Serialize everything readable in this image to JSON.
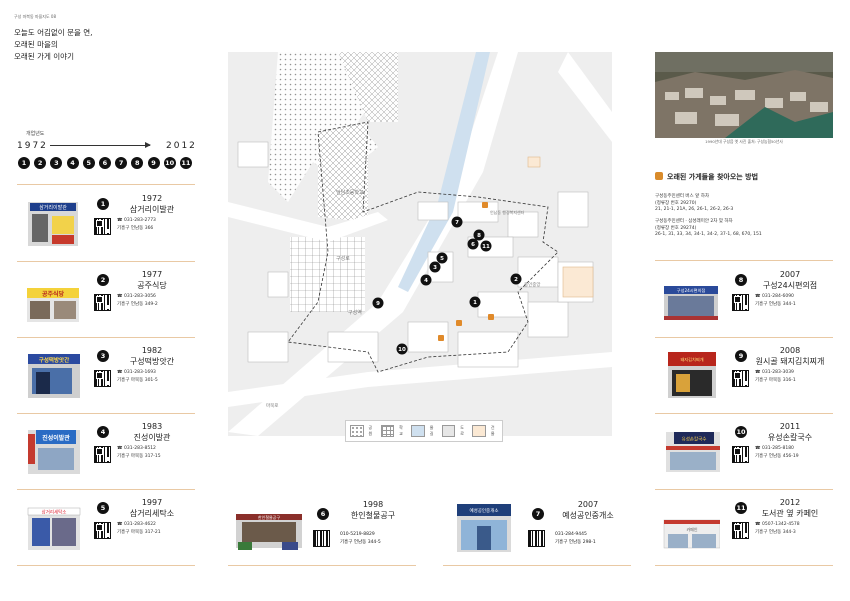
{
  "header": {
    "small": "구성 마북동 마을지도 08",
    "title_lines": [
      "오늘도 어김없이 문을 연,",
      "오래된 마을의",
      "오래된 가게 이야기"
    ]
  },
  "timeline": {
    "label": "개업년도",
    "start": "1972",
    "end": "2012",
    "numbers": [
      "1",
      "2",
      "3",
      "4",
      "5",
      "6",
      "7",
      "8",
      "9",
      "10",
      "11"
    ]
  },
  "shops": [
    {
      "num": "1",
      "year": "1972",
      "name": "삼거리이발관",
      "tel": "031-283-2773",
      "addr": "기흥구 언남동 366",
      "sign": "삼거리이발관"
    },
    {
      "num": "2",
      "year": "1977",
      "name": "공주식당",
      "tel": "031-283-3056",
      "addr": "기흥구 언남동 349-2",
      "sign": "공주식당"
    },
    {
      "num": "3",
      "year": "1982",
      "name": "구성떡방앗간",
      "tel": "031-283-1693",
      "addr": "기흥구 마북동 301-5",
      "sign": "구성떡방앗간"
    },
    {
      "num": "4",
      "year": "1983",
      "name": "진성이발관",
      "tel": "031-283-8512",
      "addr": "기흥구 마북동 317-15",
      "sign": "진성이발관"
    },
    {
      "num": "5",
      "year": "1997",
      "name": "삼거리세탁소",
      "tel": "031-283-4622",
      "addr": "기흥구 마북동 317-21",
      "sign": "삼거리세탁소"
    },
    {
      "num": "6",
      "year": "1998",
      "name": "한인철물공구",
      "tel": "010-5219-8829",
      "addr": "기흥구 언남동 344-5",
      "sign": "한인철물공구"
    },
    {
      "num": "7",
      "year": "2007",
      "name": "예성공인중개소",
      "tel": "031-284-9445",
      "addr": "기흥구 언남동 298-1",
      "sign": "예성공인중개소"
    },
    {
      "num": "8",
      "year": "2007",
      "name": "구성24시편의점",
      "tel": "031-284-6090",
      "addr": "기흥구 언남동 344-1",
      "sign": "구성24시편의점"
    },
    {
      "num": "9",
      "year": "2008",
      "name": "원시골 돼지김치찌개",
      "tel": "031-283-3039",
      "addr": "기흥구 마북동 316-1",
      "sign": "돼지김치찌개"
    },
    {
      "num": "10",
      "year": "2011",
      "name": "유성손칼국수",
      "tel": "031-285-8180",
      "addr": "기흥구 언남동 456-19",
      "sign": "유성손칼국수"
    },
    {
      "num": "11",
      "year": "2012",
      "name": "도서관 옆 카페인",
      "tel": "0507-1342-4578",
      "addr": "기흥구 언남동 344-3",
      "sign": "카페인"
    }
  ],
  "map": {
    "labels": {
      "school": "언남초등학교",
      "station": "구성역",
      "road": "구성로",
      "gov": "언남동 행정복지센터",
      "road2": "마북로",
      "park": "용인중앙"
    },
    "legend": [
      "공원",
      "학교",
      "물길",
      "도로",
      "건물"
    ]
  },
  "aside": {
    "photo_caption": "1990년대 구성읍 옛 사진 출처: 구성농협50년사",
    "route_title": "오래된 가게들을 찾아오는 방법",
    "route1_title": "구성동주민센터 버스 앞 하차",
    "route1_stop": "(정류장 번호 29270)",
    "route1_buses": "21, 21-1, 21A, 26, 26-1, 26-2, 26-3",
    "route2_title": "구성동주민센터 · 삼성래미안 2차 맞 하차",
    "route2_stop": "(정류장 번호 29274)",
    "route2_buses": "26-1, 31, 33, 34, 34-1, 34-2, 37-1, 68, 670, 151"
  },
  "colors": {
    "accent_rule": "#e9c9a4",
    "bus_orange": "#d98b2b",
    "marker": "#111111"
  }
}
